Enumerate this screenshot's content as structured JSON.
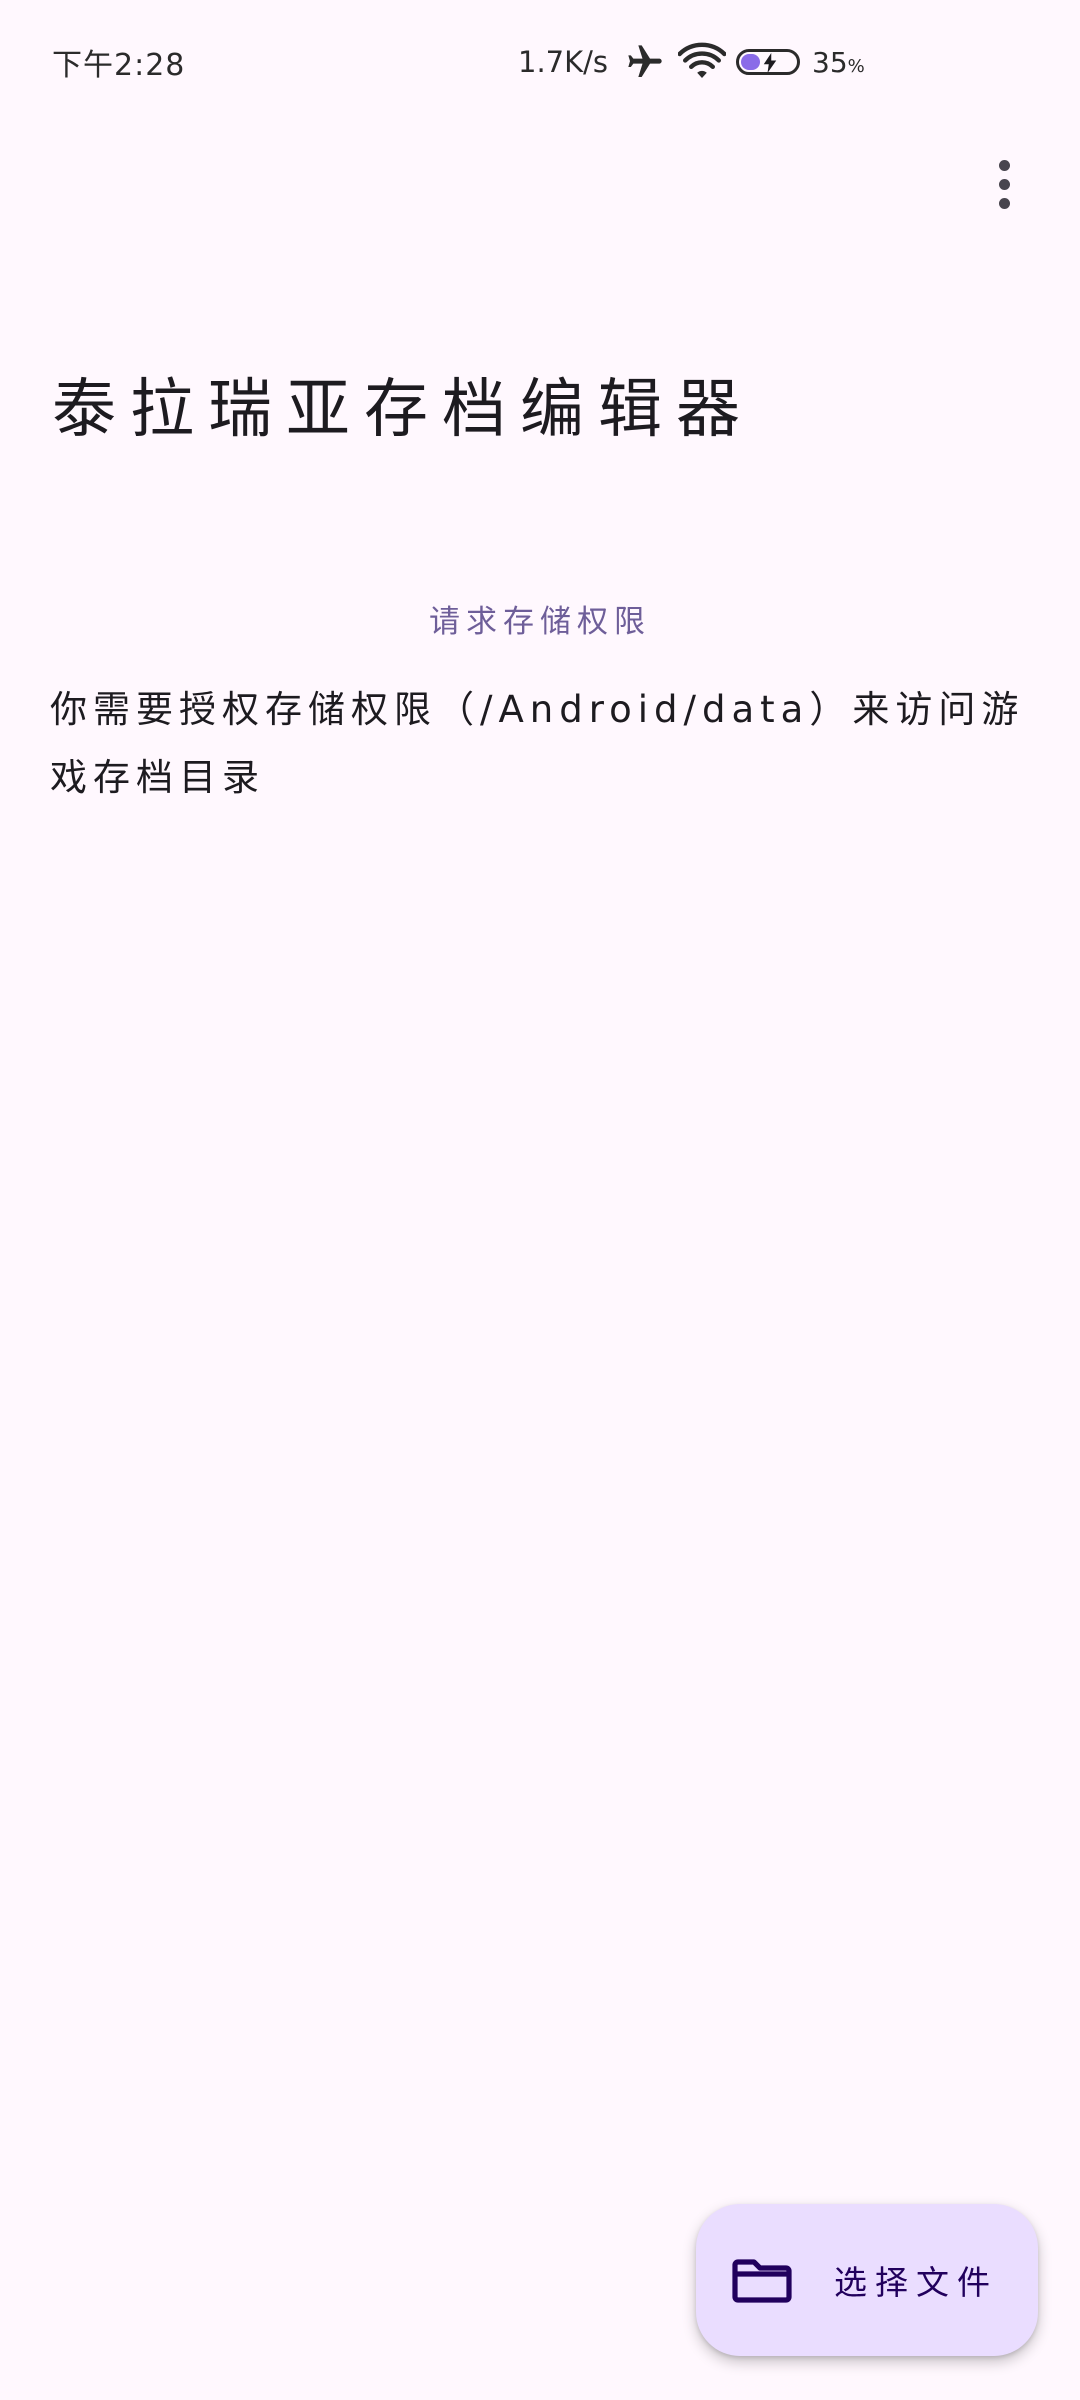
{
  "status_bar": {
    "time": "下午2:28",
    "net_speed": "1.7K/s",
    "battery_percent": "35",
    "battery_unit": "%",
    "battery_level": 0.35,
    "battery_charging": true,
    "icons": [
      "airplane-icon",
      "wifi-icon",
      "battery-icon"
    ]
  },
  "app_bar": {
    "overflow_icon": "more-vert-icon"
  },
  "main": {
    "title": "泰拉瑞亚存档编辑器",
    "permission": {
      "title": "请求存储权限",
      "body": "你需要授权存储权限（/Android/data）来访问游戏存档目录"
    }
  },
  "fab": {
    "icon": "folder-icon",
    "label": "选择文件"
  },
  "colors": {
    "background": "#FFF8FE",
    "fab_container": "#EADDFF",
    "fab_content": "#21005D",
    "section_title": "#6E5E99",
    "battery_fill": "#8A6BE8"
  }
}
